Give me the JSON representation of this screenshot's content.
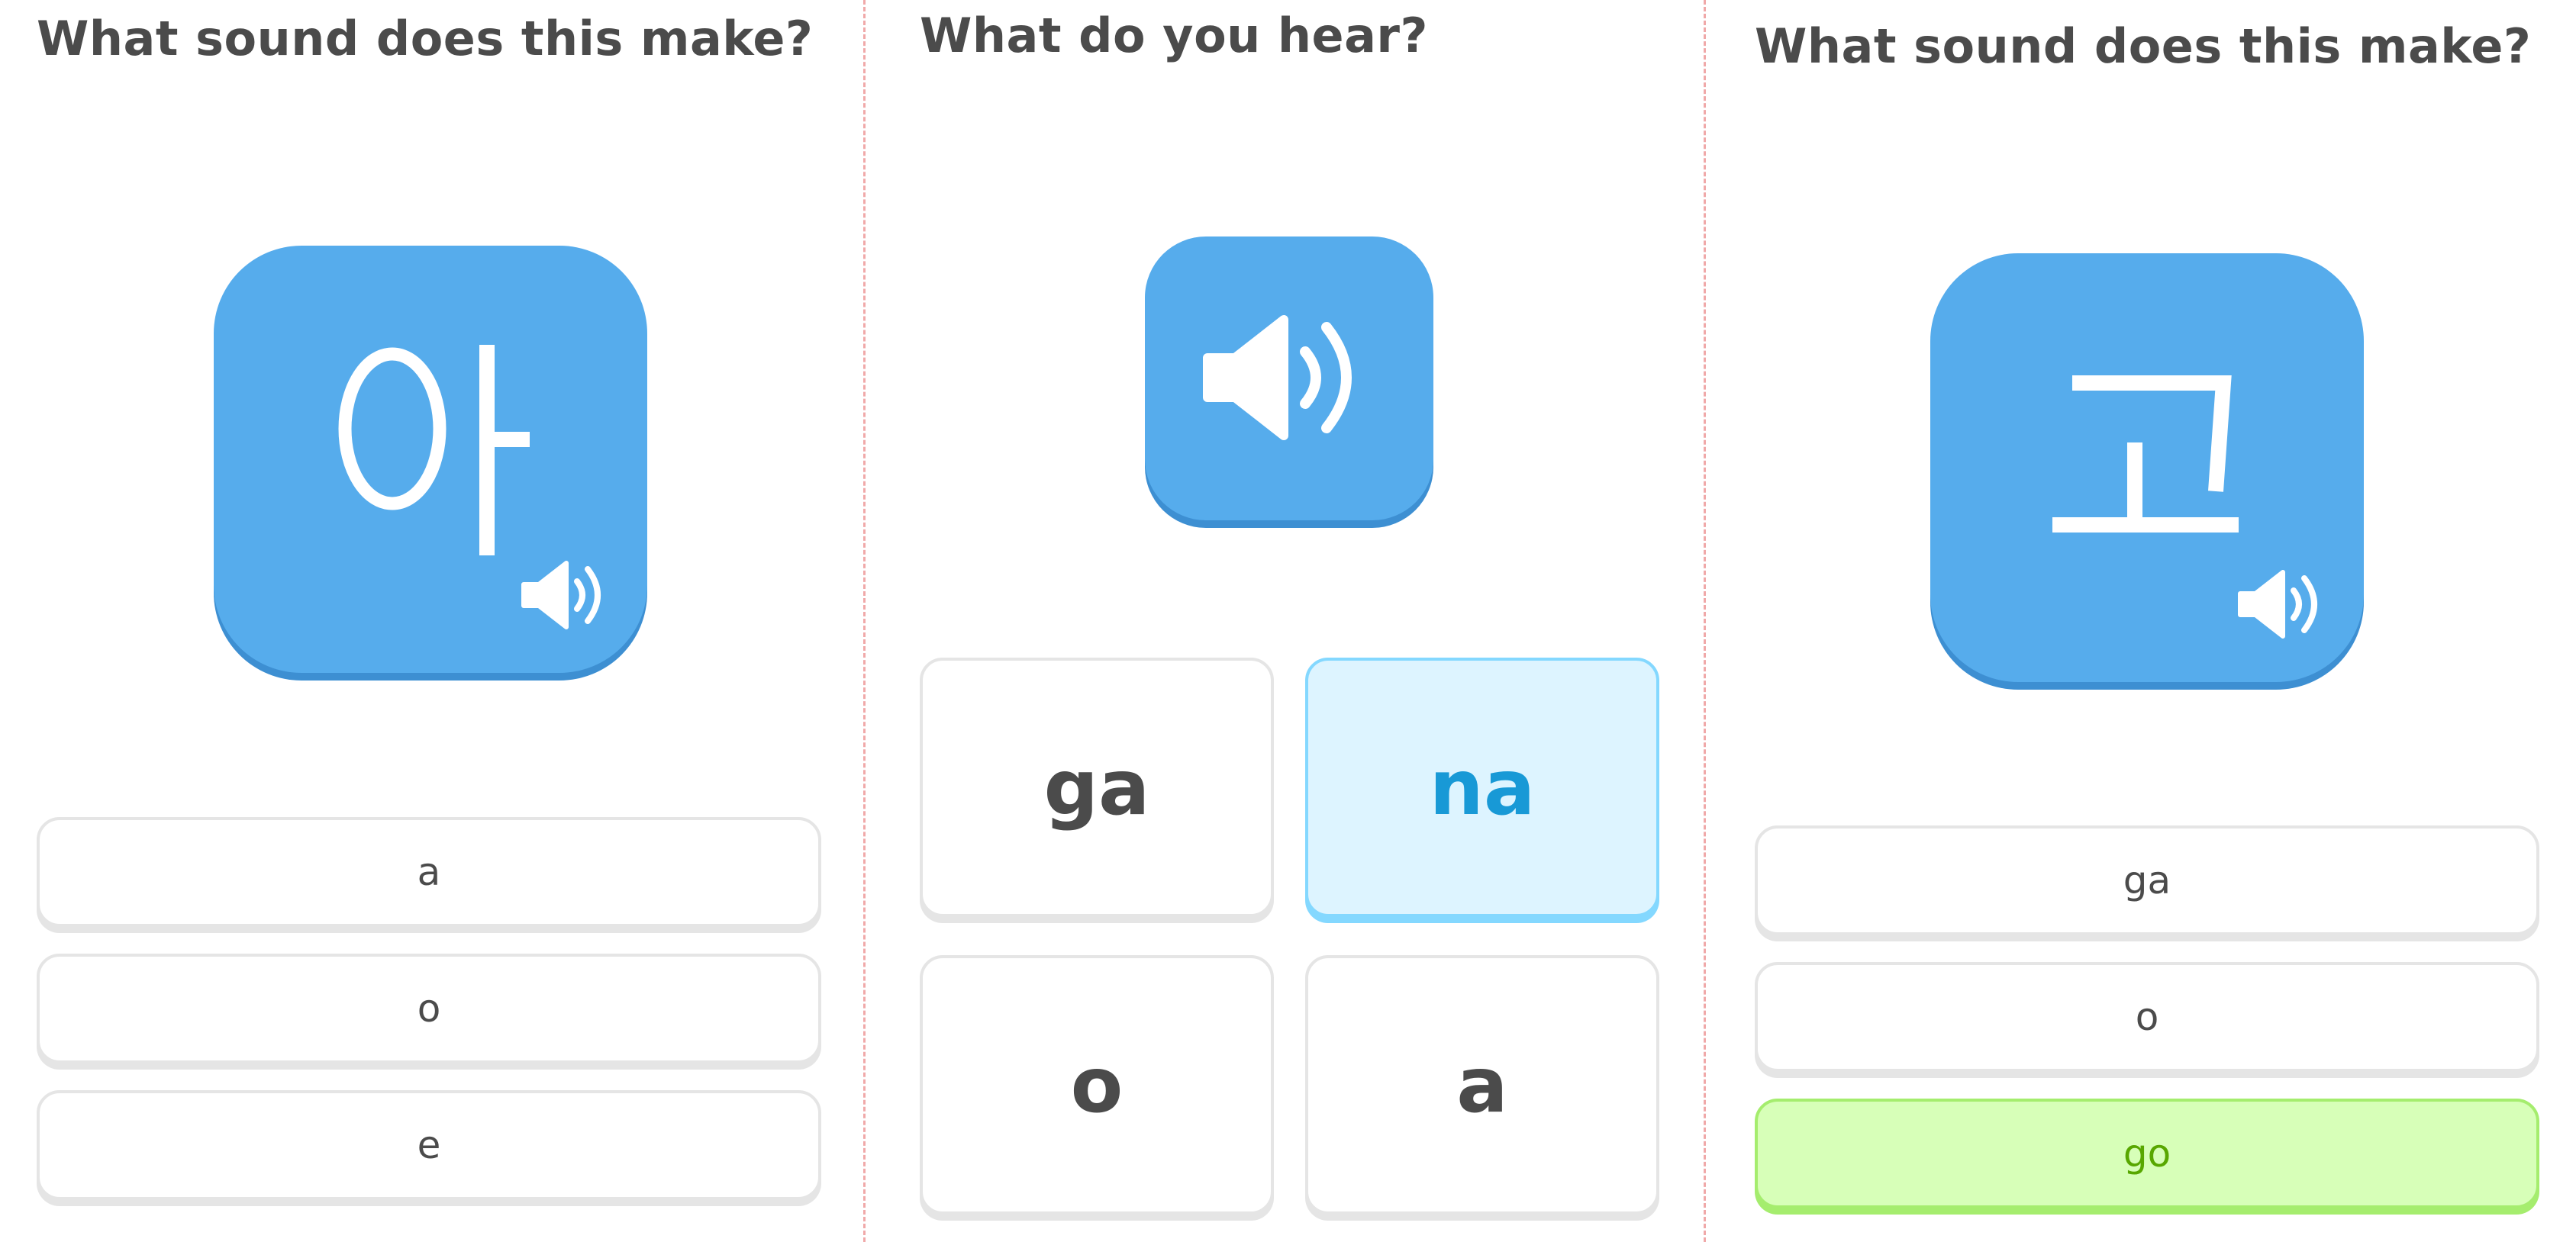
{
  "panels": [
    {
      "title": "What sound does this make?",
      "character": "아",
      "options": [
        {
          "label": "a",
          "state": "default"
        },
        {
          "label": "o",
          "state": "default"
        },
        {
          "label": "e",
          "state": "default"
        }
      ]
    },
    {
      "title": "What do you hear?",
      "cards": [
        {
          "label": "ga",
          "state": "default"
        },
        {
          "label": "na",
          "state": "selected"
        },
        {
          "label": "o",
          "state": "default"
        },
        {
          "label": "a",
          "state": "default"
        }
      ]
    },
    {
      "title": "What sound does this make?",
      "character": "고",
      "options": [
        {
          "label": "ga",
          "state": "default"
        },
        {
          "label": "o",
          "state": "default"
        },
        {
          "label": "go",
          "state": "correct"
        }
      ]
    }
  ],
  "icons": {
    "audio": "speaker-icon"
  },
  "colors": {
    "tile_blue": "#56acec",
    "selected_blue": "#1899d6",
    "correct_green": "#58a700",
    "divider": "#f0a9a9"
  }
}
